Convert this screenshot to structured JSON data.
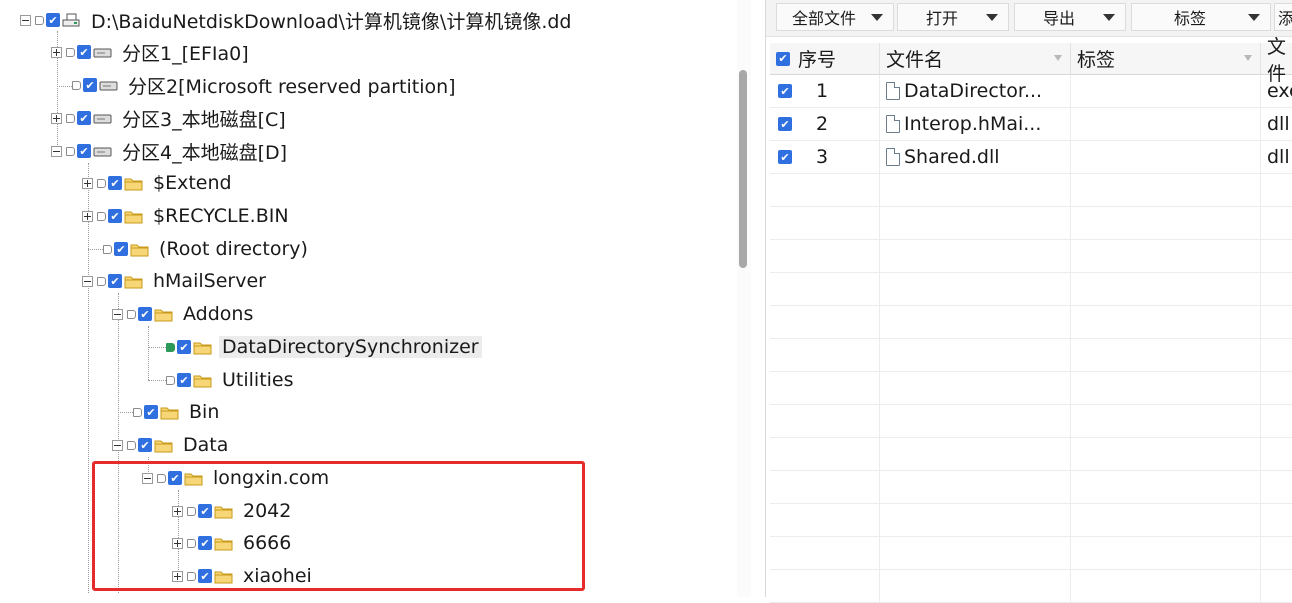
{
  "tree": {
    "nodes": [
      {
        "label": "D:\\BaiduNetdiskDownload\\计算机镜像\\计算机镜像.dd",
        "icon": "disk-image-icon"
      },
      {
        "label": "分区1_[EFIa0]",
        "icon": "partition-icon"
      },
      {
        "label": "分区2[Microsoft reserved partition]",
        "icon": "partition-icon"
      },
      {
        "label": "分区3_本地磁盘[C]",
        "icon": "partition-icon"
      },
      {
        "label": "分区4_本地磁盘[D]",
        "icon": "partition-icon"
      },
      {
        "label": "$Extend",
        "icon": "folder-icon"
      },
      {
        "label": "$RECYCLE.BIN",
        "icon": "folder-icon"
      },
      {
        "label": "(Root directory)",
        "icon": "folder-icon"
      },
      {
        "label": "hMailServer",
        "icon": "folder-icon"
      },
      {
        "label": "Addons",
        "icon": "folder-icon"
      },
      {
        "label": "DataDirectorySynchronizer",
        "icon": "folder-icon",
        "selected": true
      },
      {
        "label": "Utilities",
        "icon": "folder-icon"
      },
      {
        "label": "Bin",
        "icon": "folder-icon"
      },
      {
        "label": "Data",
        "icon": "folder-icon"
      },
      {
        "label": "longxin.com",
        "icon": "folder-icon"
      },
      {
        "label": "2042",
        "icon": "folder-icon"
      },
      {
        "label": "6666",
        "icon": "folder-icon"
      },
      {
        "label": "xiaohei",
        "icon": "folder-icon"
      }
    ]
  },
  "toolbar": {
    "all_files": "全部文件",
    "open": "打开",
    "export": "导出",
    "tags": "标签",
    "add_partial": "添"
  },
  "table": {
    "headers": {
      "index": "序号",
      "filename": "文件名",
      "tag": "标签",
      "type_partial": "文件"
    },
    "rows": [
      {
        "index": "1",
        "filename": "DataDirector...",
        "tag": "",
        "type": "exe"
      },
      {
        "index": "2",
        "filename": "Interop.hMai...",
        "tag": "",
        "type": "dll"
      },
      {
        "index": "3",
        "filename": "Shared.dll",
        "tag": "",
        "type": "dll"
      }
    ]
  },
  "colors": {
    "highlight_box": "#e52b2b",
    "checkbox": "#2f6fe0",
    "folder": "#f1c232",
    "selected_tag": "#2e9a5a"
  }
}
